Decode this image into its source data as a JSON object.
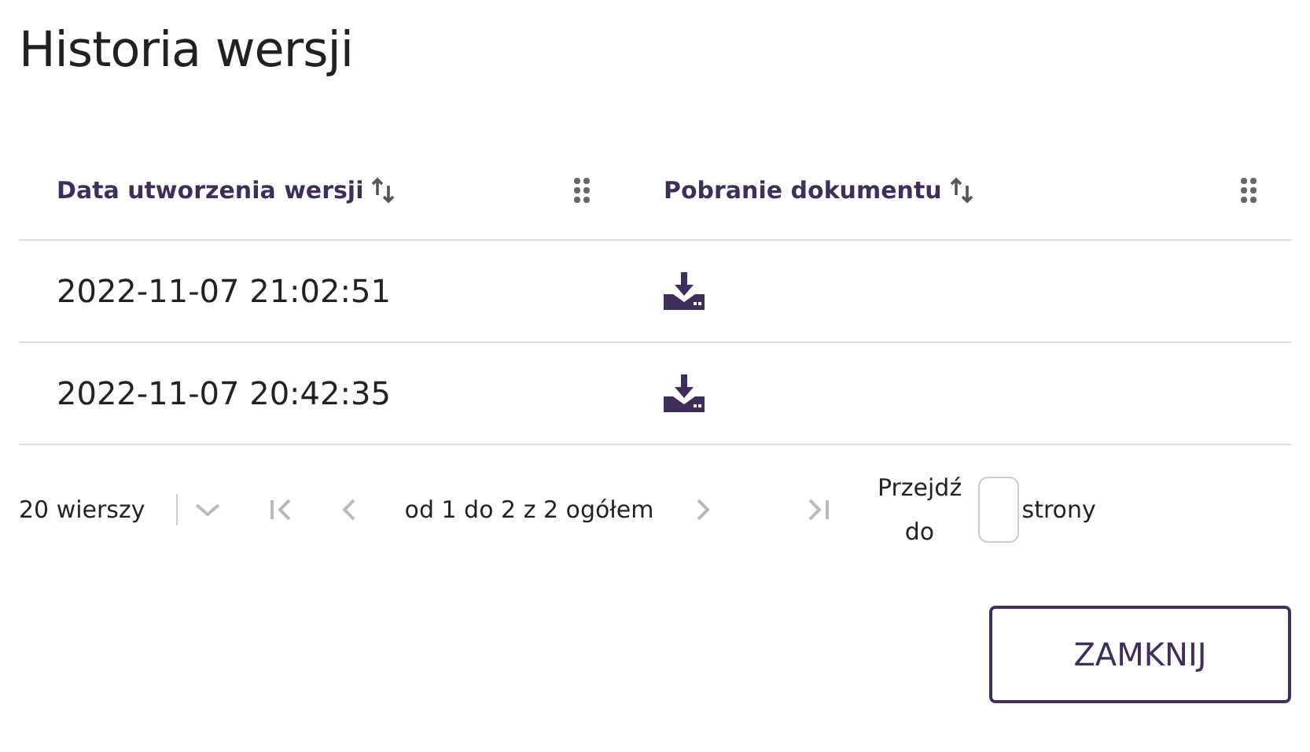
{
  "dialog": {
    "title": "Historia wersji"
  },
  "table": {
    "columns": [
      {
        "label": "Data utworzenia wersji"
      },
      {
        "label": "Pobranie dokumentu"
      }
    ],
    "rows": [
      {
        "date": "2022-11-07 21:02:51"
      },
      {
        "date": "2022-11-07 20:42:35"
      }
    ]
  },
  "pagination": {
    "page_size": "20 wierszy",
    "range": "od 1 do 2 z 2 ogółem",
    "goto_label": "Przejdź do",
    "goto_suffix": "strony"
  },
  "buttons": [
    {
      "label": "ZAMKNIJ"
    }
  ]
}
